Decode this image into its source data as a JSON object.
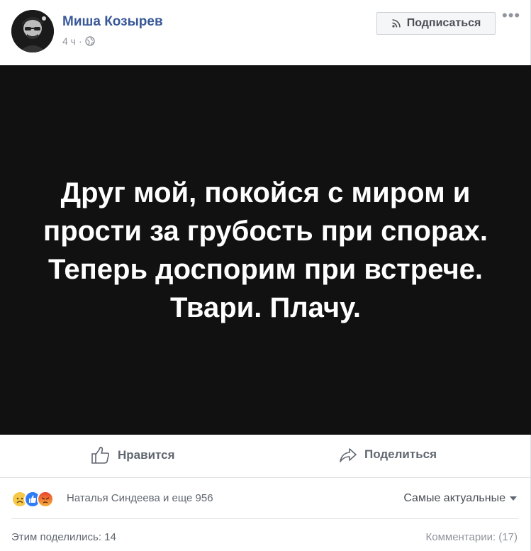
{
  "post": {
    "author": "Миша Козырев",
    "time": "4 ч",
    "time_separator": "·",
    "subscribe_label": "Подписаться",
    "more_label": "•••",
    "image_text": "Друг мой, покойся с миром и прости за грубость при спорах. Теперь доспорим при встрече. Твари. Плачу."
  },
  "actions": {
    "like_label": "Нравится",
    "share_label": "Поделиться"
  },
  "reactions": {
    "summary": "Наталья Синдеева и еще 956",
    "icons": [
      "sad-reaction-icon",
      "like-reaction-icon",
      "angry-reaction-icon"
    ],
    "sort_label": "Самые актуальные"
  },
  "footer": {
    "shared_label": "Этим поделились: 14",
    "comments_label": "Комментарии: (17)"
  },
  "colors": {
    "author_link": "#385898",
    "image_background": "#111111",
    "like_blue": "#2f7df6"
  }
}
